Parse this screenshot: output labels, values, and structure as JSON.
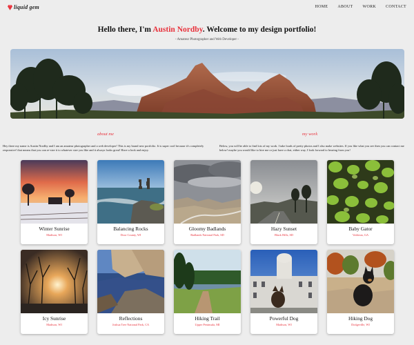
{
  "nav": {
    "logo_text": "liquid gem",
    "links": [
      "HOME",
      "ABOUT",
      "WORK",
      "CONTACT"
    ]
  },
  "hero": {
    "title_prefix": "Hello there, I'm ",
    "title_name": "Austin Nordby",
    "title_suffix": ". Welcome to my design portfolio!",
    "subtitle": "- Amateur Photographer and Web Developer -"
  },
  "about": {
    "heading": "about me",
    "text": "Hey there my name is Austin Nordby and I am an amateur photographer and a web developer! This is my brand new portfolio. It is super cool because it's completely responsive! that means that you can re-size it to whatever size you like and it always looks great! Have a look and enjoy."
  },
  "work": {
    "heading": "my work",
    "text": "Below, you will be able to find lots of my work. I take loads of pretty photos and I also make websites. If you like what you see then you can contact me below! maybe you would like to hire me or just have a chat, either way, I look forward to hearing from you!"
  },
  "cards": [
    {
      "title": "Winter Sunrise",
      "location": "Madison, WI",
      "image": "winter-sunrise-photo"
    },
    {
      "title": "Balancing Rocks",
      "location": "Door County, WI",
      "image": "balancing-rocks-photo"
    },
    {
      "title": "Gloomy Badlands",
      "location": "Badlands National Park, SD",
      "image": "badlands-photo"
    },
    {
      "title": "Hazy Sunset",
      "location": "Black Hills, SD",
      "image": "hazy-sunset-photo"
    },
    {
      "title": "Baby Gator",
      "location": "Valdosta, GA",
      "image": "baby-gator-photo"
    },
    {
      "title": "Icy Sunrise",
      "location": "Madison, WI",
      "image": "icy-sunrise-photo"
    },
    {
      "title": "Reflections",
      "location": "Joshua Tree National Park, CA",
      "image": "reflections-photo"
    },
    {
      "title": "Hiking Trail",
      "location": "Upper Peninsula, MI",
      "image": "hiking-trail-photo"
    },
    {
      "title": "Powerful Dog",
      "location": "Madison, WI",
      "image": "powerful-dog-photo"
    },
    {
      "title": "Hiking Dog",
      "location": "Dodgeville, WI",
      "image": "hiking-dog-photo"
    }
  ],
  "colors": {
    "accent": "#e8323c",
    "background": "#ededed",
    "card": "#ffffff"
  }
}
